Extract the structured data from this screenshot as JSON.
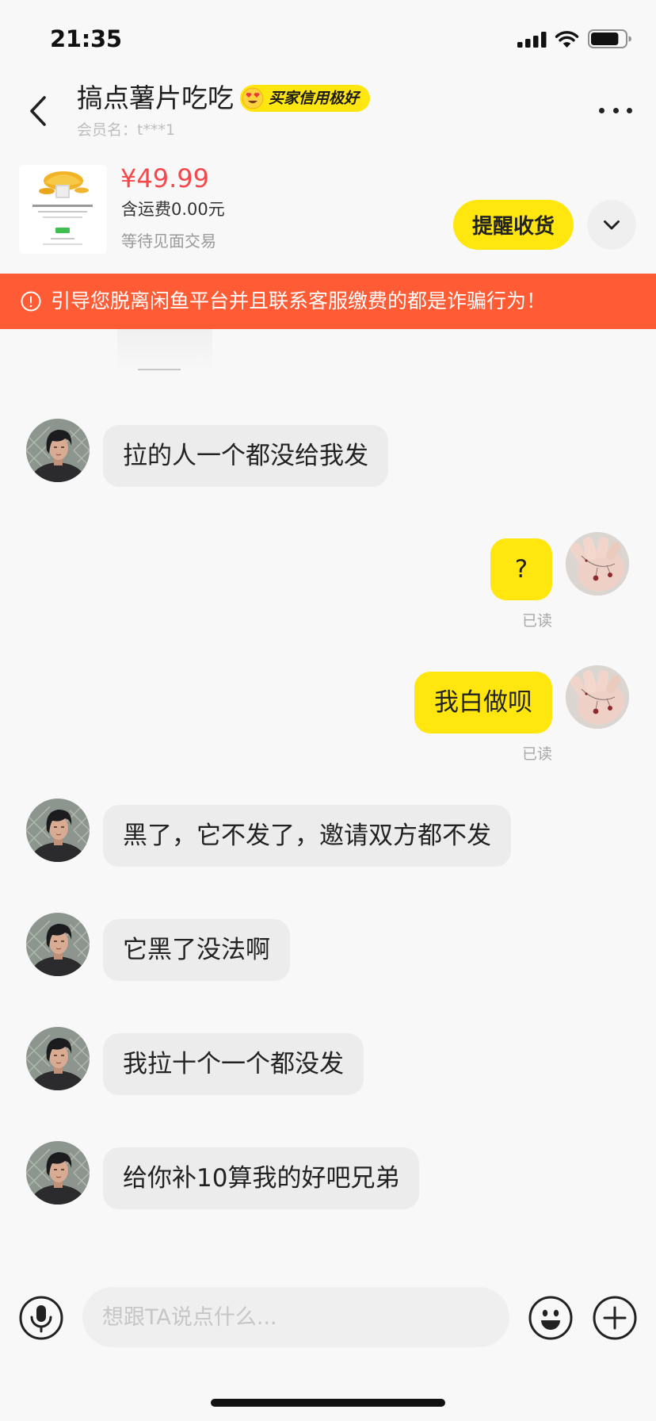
{
  "status_bar": {
    "time": "21:35",
    "signal_bars": 4,
    "battery_level": 0.82,
    "icons": [
      "cellular-signal-icon",
      "wifi-icon",
      "battery-icon"
    ]
  },
  "header": {
    "back_icon": "chevron-left-icon",
    "title": "搞点薯片吃吃",
    "badge_icon": "heart-eyes-icon",
    "badge": "买家信用极好",
    "member": "会员名：t***1",
    "more_icon": "more-dots-icon"
  },
  "product": {
    "price": "¥49.99",
    "shipping": "含运费0.00元",
    "status": "等待见面交易",
    "action_button": "提醒收货",
    "expand_icon": "chevron-down-icon"
  },
  "warning": {
    "icon": "alert-circle-icon",
    "text": "引导您脱离闲鱼平台并且联系客服缴费的都是诈骗行为！"
  },
  "messages": [
    {
      "outgoing": false,
      "text": "拉的人一个都没给我发"
    },
    {
      "outgoing": true,
      "text": "?",
      "receipt": "已读"
    },
    {
      "outgoing": true,
      "text": "我白做呗",
      "receipt": "已读"
    },
    {
      "outgoing": false,
      "text": "黑了，它不发了，邀请双方都不发"
    },
    {
      "outgoing": false,
      "text": "它黑了没法啊"
    },
    {
      "outgoing": false,
      "text": "我拉十个一个都没发"
    },
    {
      "outgoing": false,
      "text": "给你补10算我的好吧兄弟"
    }
  ],
  "composer": {
    "placeholder": "想跟TA说点什么...",
    "icons": [
      "microphone-icon",
      "emoji-icon",
      "plus-icon"
    ]
  },
  "colors": {
    "accent_yellow": "#FFE60F",
    "warning_banner": "#FF5B34",
    "price_red": "#F5484A",
    "page_background": "#F8F8F8",
    "incoming_bubble": "#ECECEC"
  }
}
